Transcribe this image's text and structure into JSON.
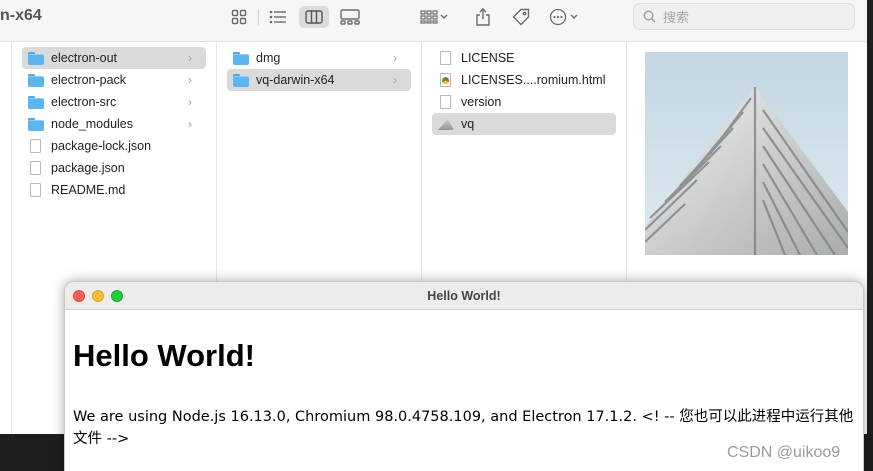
{
  "finder": {
    "title_fragment": "n-x64",
    "search_placeholder": "搜索",
    "columns": [
      {
        "items": [
          {
            "label": "electron-out",
            "kind": "folder",
            "selected": true,
            "chevron": true
          },
          {
            "label": "electron-pack",
            "kind": "folder",
            "selected": false,
            "chevron": true
          },
          {
            "label": "electron-src",
            "kind": "folder",
            "selected": false,
            "chevron": true
          },
          {
            "label": "node_modules",
            "kind": "folder",
            "selected": false,
            "chevron": true
          },
          {
            "label": "package-lock.json",
            "kind": "document",
            "selected": false,
            "chevron": false
          },
          {
            "label": "package.json",
            "kind": "document",
            "selected": false,
            "chevron": false
          },
          {
            "label": "README.md",
            "kind": "document",
            "selected": false,
            "chevron": false
          }
        ]
      },
      {
        "items": [
          {
            "label": "dmg",
            "kind": "folder",
            "selected": false,
            "chevron": true
          },
          {
            "label": "vq-darwin-x64",
            "kind": "folder",
            "selected": true,
            "chevron": true
          }
        ]
      },
      {
        "items": [
          {
            "label": "LICENSE",
            "kind": "document",
            "selected": false,
            "chevron": false
          },
          {
            "label": "LICENSES....romium.html",
            "kind": "html-document",
            "selected": false,
            "chevron": false
          },
          {
            "label": "version",
            "kind": "document",
            "selected": false,
            "chevron": false
          },
          {
            "label": "vq",
            "kind": "application",
            "selected": true,
            "chevron": false
          }
        ]
      }
    ],
    "chevron_glyph": "›",
    "toolbar_icons": [
      "grid-view-icon",
      "list-view-icon",
      "column-view-icon",
      "gallery-view-icon",
      "group-icon",
      "share-icon",
      "tag-icon",
      "more-actions-icon",
      "search-icon"
    ]
  },
  "electron_window": {
    "title": "Hello World!",
    "heading": "Hello World!",
    "text": "We are using Node.js 16.13.0, Chromium 98.0.4758.109, and Electron 17.1.2. <!  -- 您也可以此进程中运行其他文件 -->",
    "traffic_lights": [
      "#fe5f57",
      "#febc2e",
      "#28c840"
    ]
  },
  "watermark": "CSDN @uikoo9",
  "colors": {
    "selection": "#dadada",
    "folder": "#5db5f0",
    "desktop": "#1e1e1e"
  }
}
